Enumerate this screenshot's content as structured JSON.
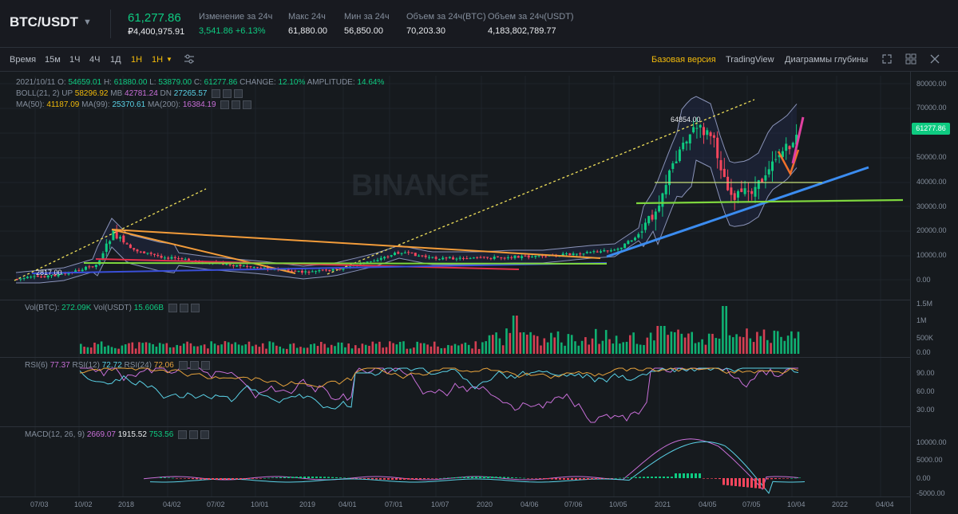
{
  "header": {
    "symbol": "BTC/USDT",
    "price": "61,277.86",
    "price_rub": "₽4,400,975.91",
    "stats": [
      {
        "label": "Изменение за 24ч",
        "value": "3,541.86 +6.13%",
        "green": true
      },
      {
        "label": "Макс 24ч",
        "value": "61,880.00"
      },
      {
        "label": "Мин за 24ч",
        "value": "56,850.00"
      },
      {
        "label": "Объем за 24ч(BTC)",
        "value": "70,203.30"
      },
      {
        "label": "Объем за 24ч(USDT)",
        "value": "4,183,802,789.77"
      }
    ]
  },
  "toolbar": {
    "timeframes": [
      "Время",
      "15м",
      "1Ч",
      "4Ч",
      "1Д",
      "1Н",
      "1Н"
    ],
    "active_timeframe": "1Н",
    "views": [
      "Базовая версия",
      "TradingView",
      "Диаграммы глубины"
    ],
    "active_view": "Базовая версия",
    "icons": [
      "indicator-settings-icon",
      "fullscreen-icon",
      "layout-grid-icon",
      "close-icon"
    ]
  },
  "legends": {
    "ohlc": {
      "date": "2021/10/11",
      "o_label": "O:",
      "o": "54659.01",
      "h_label": "H:",
      "h": "61880.00",
      "l_label": "L:",
      "l": "53879.00",
      "c_label": "C:",
      "c": "61277.86",
      "change_label": "CHANGE:",
      "change": "12.10%",
      "amp_label": "AMPLITUDE:",
      "amp": "14.64%"
    },
    "boll": {
      "name": "BOLL(21, 2)",
      "up_label": "UP",
      "up": "58296.92",
      "mb_label": "MB",
      "mb": "42781.24",
      "dn_label": "DN",
      "dn": "27265.57"
    },
    "ma": {
      "ma50_label": "MA(50):",
      "ma50": "41187.09",
      "ma99_label": "MA(99):",
      "ma99": "25370.61",
      "ma200_label": "MA(200):",
      "ma200": "16384.19"
    },
    "vol": {
      "btc_label": "Vol(BTC):",
      "btc": "272.09K",
      "usdt_label": "Vol(USDT)",
      "usdt": "15.606B"
    },
    "rsi": {
      "r6_label": "RSI(6)",
      "r6": "77.37",
      "r12_label": "RSI(12)",
      "r12": "72.72",
      "r24_label": "RSI(24)",
      "r24": "72.06"
    },
    "macd": {
      "label": "MACD(12, 26, 9)",
      "v1": "2669.07",
      "v2": "1915.52",
      "v3": "753.56"
    }
  },
  "price_axis": [
    "80000.00",
    "70000.00",
    "60000.00",
    "50000.00",
    "40000.00",
    "30000.00",
    "20000.00",
    "10000.00",
    "0.00"
  ],
  "last_price_tag": "61277.86",
  "peak_label": "64854.00",
  "low_label": "2817.00",
  "watermark": "BINANCE",
  "vol_axis": [
    "1.5M",
    "1M",
    "500K",
    "0.00"
  ],
  "rsi_axis": [
    "90.00",
    "60.00",
    "30.00"
  ],
  "macd_axis": [
    "10000.00",
    "5000.00",
    "0.00",
    "-5000.00"
  ],
  "time_axis": [
    "07/03",
    "10/02",
    "2018",
    "04/02",
    "07/02",
    "10/01",
    "2019",
    "04/01",
    "07/01",
    "10/07",
    "2020",
    "04/06",
    "07/06",
    "10/05",
    "2021",
    "04/05",
    "07/05",
    "10/04",
    "2022",
    "04/04"
  ],
  "colors": {
    "up": "#0ecb81",
    "down": "#f6465d",
    "accent": "#f0b90b",
    "background": "#161a1e"
  }
}
